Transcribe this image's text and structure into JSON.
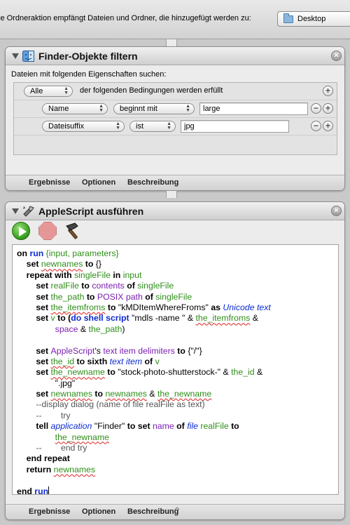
{
  "top_bar": {
    "text": "ie Ordneraktion empfängt Dateien und Ordner, die hinzugefügt werden zu:",
    "folder_selection": "Desktop",
    "folder_icon": "folder-icon"
  },
  "filter_action": {
    "title": "Finder-Objekte filtern",
    "icon": "finder-icon",
    "search_label": "Dateien mit folgenden Eigenschaften suchen:",
    "match_mode": "Alle",
    "match_text": "der folgenden Bedingungen werden erfüllt",
    "conditions": [
      {
        "attribute": "Name",
        "operator": "beginnt mit",
        "value": "large"
      },
      {
        "attribute": "Dateisuffix",
        "operator": "ist",
        "value": "jpg"
      }
    ],
    "add_symbol": "+",
    "remove_symbol": "−",
    "footer": {
      "results": "Ergebnisse",
      "options": "Optionen",
      "description": "Beschreibung"
    }
  },
  "script_action": {
    "title": "AppleScript ausführen",
    "icon": "applescript-icon",
    "toolbar": {
      "run": "run-icon",
      "stop": "stop-icon",
      "compile": "hammer-icon"
    },
    "script_lines": [
      [
        [
          "on ",
          "kw"
        ],
        [
          "run",
          "kw bl"
        ],
        [
          " {input, parameters}",
          "gr"
        ]
      ],
      [
        [
          "\t",
          ""
        ],
        [
          "set ",
          "kw"
        ],
        [
          "newnames",
          "gr sq"
        ],
        [
          " to ",
          "kw"
        ],
        [
          "{}",
          ""
        ]
      ],
      [
        [
          "\t",
          ""
        ],
        [
          "repeat with ",
          "kw"
        ],
        [
          "singleFile",
          "gr"
        ],
        [
          " in ",
          "kw"
        ],
        [
          "input",
          "gr"
        ]
      ],
      [
        [
          "\t\t",
          ""
        ],
        [
          "set ",
          "kw"
        ],
        [
          "realFile",
          "gr"
        ],
        [
          " to ",
          "kw"
        ],
        [
          "contents",
          "pu"
        ],
        [
          " of ",
          "kw"
        ],
        [
          "singleFile",
          "gr"
        ]
      ],
      [
        [
          "\t\t",
          ""
        ],
        [
          "set ",
          "kw"
        ],
        [
          "the_path",
          "gr"
        ],
        [
          " to ",
          "kw"
        ],
        [
          "POSIX path",
          "pu"
        ],
        [
          " of ",
          "kw"
        ],
        [
          "singleFile",
          "gr"
        ]
      ],
      [
        [
          "\t\t",
          ""
        ],
        [
          "set ",
          "kw"
        ],
        [
          "the_itemfroms",
          "gr sq"
        ],
        [
          " to ",
          "kw"
        ],
        [
          "\"kMDItemWhereFroms\"",
          ""
        ],
        [
          " as ",
          "kw"
        ],
        [
          "Unicode text",
          "it"
        ]
      ],
      [
        [
          "\t\t",
          ""
        ],
        [
          "set ",
          "kw"
        ],
        [
          "v",
          "gr"
        ],
        [
          " to (",
          "kw"
        ],
        [
          "do shell script",
          "kw bl"
        ],
        [
          " \"mdls -name \" & ",
          ""
        ],
        [
          "the_itemfroms",
          "gr sq"
        ],
        [
          " &",
          ""
        ]
      ],
      [
        [
          "\t\t\t\t",
          ""
        ],
        [
          "space",
          "pu"
        ],
        [
          " & ",
          ""
        ],
        [
          "the_path",
          "gr"
        ],
        [
          ")",
          ""
        ]
      ],
      [
        [
          "",
          ""
        ]
      ],
      [
        [
          "\t\t",
          ""
        ],
        [
          "set ",
          "kw"
        ],
        [
          "AppleScript",
          "pu"
        ],
        [
          "'s ",
          ""
        ],
        [
          "text item delimiters",
          "pu"
        ],
        [
          " to ",
          "kw"
        ],
        [
          "{\"/\"}",
          ""
        ]
      ],
      [
        [
          "\t\t",
          ""
        ],
        [
          "set ",
          "kw"
        ],
        [
          "the_id",
          "gr sq"
        ],
        [
          " to ",
          "kw"
        ],
        [
          "sixth ",
          "kw"
        ],
        [
          "text item",
          "it"
        ],
        [
          " of ",
          "kw"
        ],
        [
          "v",
          "gr"
        ]
      ],
      [
        [
          "\t\t",
          ""
        ],
        [
          "set ",
          "kw"
        ],
        [
          "the_newname",
          "gr sq"
        ],
        [
          " to ",
          "kw"
        ],
        [
          "\"stock-photo-shutterstock-\" & ",
          ""
        ],
        [
          "the_id",
          "gr"
        ],
        [
          " &",
          ""
        ]
      ],
      [
        [
          "\t\t\t\t",
          ""
        ],
        [
          "\".jpg\"",
          ""
        ]
      ],
      [
        [
          "\t\t",
          ""
        ],
        [
          "set ",
          "kw"
        ],
        [
          "newnames",
          "gr sq"
        ],
        [
          " to ",
          "kw"
        ],
        [
          "newnames",
          "gr sq"
        ],
        [
          " & ",
          ""
        ],
        [
          "the_newname",
          "gr sq"
        ]
      ],
      [
        [
          "\t\t",
          ""
        ],
        [
          "--display dialog (name of file realFile as text)",
          "cm"
        ]
      ],
      [
        [
          "\t\t",
          ""
        ],
        [
          "--\t\ttry",
          "cm"
        ]
      ],
      [
        [
          "\t\t",
          ""
        ],
        [
          "tell ",
          "kw"
        ],
        [
          "application",
          "it"
        ],
        [
          " \"Finder\" ",
          ""
        ],
        [
          "to set ",
          "kw"
        ],
        [
          "name",
          "pu"
        ],
        [
          " of ",
          "kw"
        ],
        [
          "file",
          "it"
        ],
        [
          " ",
          ""
        ],
        [
          "realFile",
          "gr"
        ],
        [
          " to",
          "kw"
        ]
      ],
      [
        [
          "\t\t\t\t",
          ""
        ],
        [
          "the_newname",
          "gr sq"
        ]
      ],
      [
        [
          "\t\t",
          ""
        ],
        [
          "--\t\tend try",
          "cm"
        ]
      ],
      [
        [
          "\t",
          ""
        ],
        [
          "end repeat",
          "kw"
        ]
      ],
      [
        [
          "\t",
          ""
        ],
        [
          "return ",
          "kw"
        ],
        [
          "newnames",
          "gr sq"
        ]
      ],
      [
        [
          "",
          ""
        ]
      ],
      [
        [
          "end ",
          "kw"
        ],
        [
          "run",
          "kw bl"
        ],
        [
          "|caret|",
          "caret"
        ]
      ]
    ],
    "footer": {
      "results": "Ergebnisse",
      "options": "Optionen",
      "description": "Beschreibung"
    }
  }
}
